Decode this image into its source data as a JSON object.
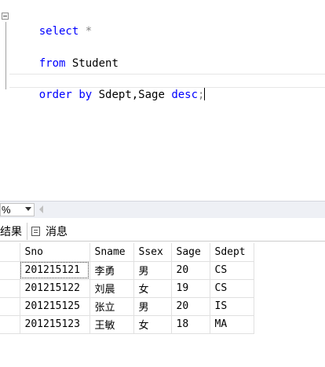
{
  "editor": {
    "line1": {
      "kw": "select",
      "rest": " *"
    },
    "line2": {
      "kw": "from",
      "rest": " Student"
    },
    "line3": {
      "kw1": "order",
      "sp": " ",
      "kw2": "by",
      "mid": " Sdept,Sage ",
      "kw3": "desc",
      "end": ";"
    }
  },
  "zoom": {
    "value": "%"
  },
  "tabs": {
    "results": "结果",
    "messages": "消息"
  },
  "grid": {
    "headers": [
      "Sno",
      "Sname",
      "Ssex",
      "Sage",
      "Sdept"
    ],
    "rows": [
      [
        "201215121",
        "李勇",
        "男",
        "20",
        "CS"
      ],
      [
        "201215122",
        "刘晨",
        "女",
        "19",
        "CS"
      ],
      [
        "201215125",
        "张立",
        "男",
        "20",
        "IS"
      ],
      [
        "201215123",
        "王敏",
        "女",
        "18",
        "MA"
      ]
    ]
  }
}
